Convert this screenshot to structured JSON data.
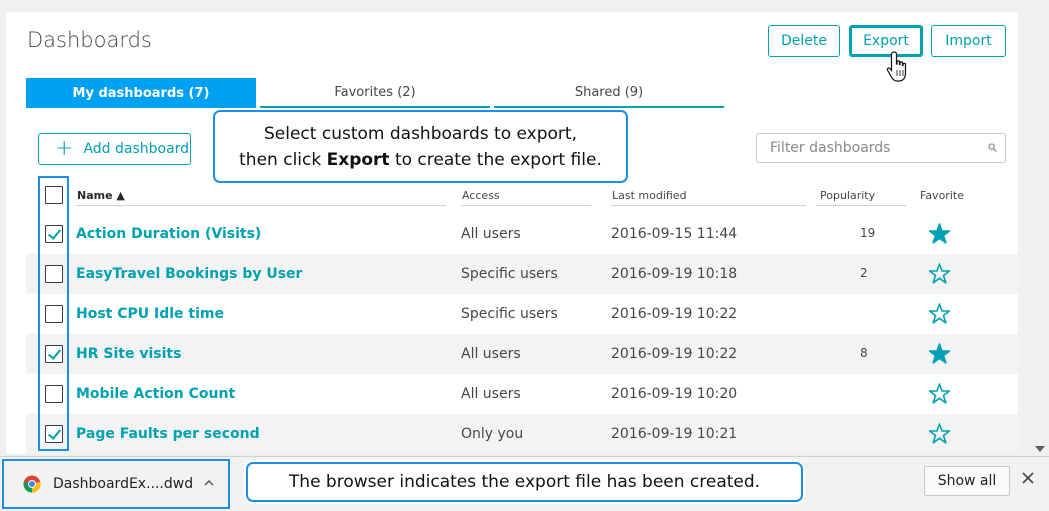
{
  "page": {
    "title": "Dashboards"
  },
  "toolbar": {
    "delete_label": "Delete",
    "export_label": "Export",
    "import_label": "Import"
  },
  "tabs": [
    {
      "label": "My dashboards (7)",
      "active": true
    },
    {
      "label": "Favorites (2)",
      "active": false
    },
    {
      "label": "Shared (9)",
      "active": false
    }
  ],
  "add_dashboard_label": "Add dashboard",
  "filter": {
    "placeholder": "Filter dashboards"
  },
  "callout_top": {
    "line1": "Select custom dashboards to export,",
    "line2_before": "then click ",
    "line2_bold": "Export",
    "line2_after": " to create the export file."
  },
  "callout_bottom": "The browser indicates the export file has been created.",
  "table": {
    "headers": {
      "name": "Name ▲",
      "access": "Access",
      "modified": "Last modified",
      "popularity": "Popularity",
      "favorite": "Favorite"
    },
    "rows": [
      {
        "name": "Action Duration (Visits)",
        "access": "All users",
        "modified": "2016-09-15 11:44",
        "popularity": "19",
        "favorite": true,
        "checked": true
      },
      {
        "name": "EasyTravel Bookings by User",
        "access": "Specific users",
        "modified": "2016-09-19 10:18",
        "popularity": "2",
        "favorite": false,
        "checked": false
      },
      {
        "name": "Host CPU Idle time",
        "access": "Specific users",
        "modified": "2016-09-19 10:22",
        "popularity": "",
        "favorite": false,
        "checked": false
      },
      {
        "name": "HR Site visits",
        "access": "All users",
        "modified": "2016-09-19 10:22",
        "popularity": "8",
        "favorite": true,
        "checked": true
      },
      {
        "name": "Mobile Action Count",
        "access": "All users",
        "modified": "2016-09-19 10:20",
        "popularity": "",
        "favorite": false,
        "checked": false
      },
      {
        "name": "Page Faults per second",
        "access": "Only you",
        "modified": "2016-09-19 10:21",
        "popularity": "",
        "favorite": false,
        "checked": true
      }
    ]
  },
  "downloads": {
    "file_name": "DashboardEx....dwd",
    "show_all_label": "Show all"
  },
  "colors": {
    "accent": "#00a1b2",
    "active_tab": "#00a1f3",
    "callout_border": "#1a8fe8"
  }
}
